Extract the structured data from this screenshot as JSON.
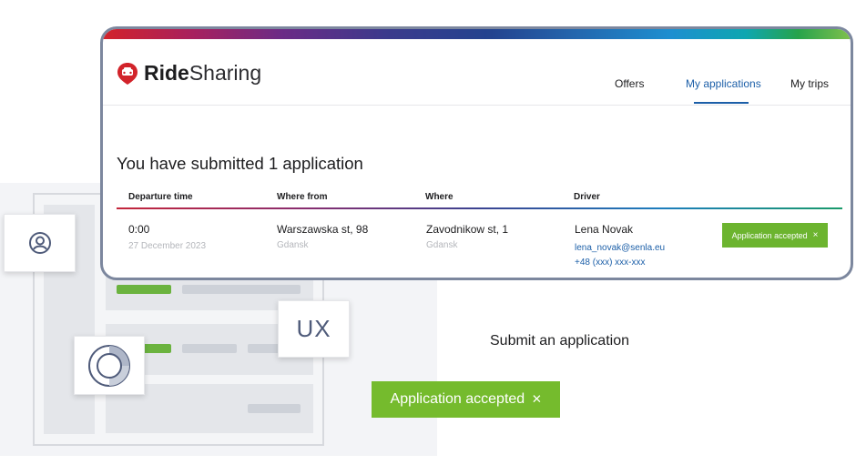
{
  "app": {
    "logo_bold": "Ride",
    "logo_light": "Sharing",
    "brand_color": "#d2232a"
  },
  "nav": {
    "offers": "Offers",
    "my_applications": "My applications",
    "my_trips": "My trips",
    "active_color": "#1c5fa8"
  },
  "page": {
    "headline": "You have submitted 1 application"
  },
  "table": {
    "headers": [
      "Departure time",
      "Where from",
      "Where",
      "Driver"
    ],
    "row": {
      "time": "0:00",
      "date": "27 December 2023",
      "from_street": "Warszawska st, 98",
      "from_city": "Gdansk",
      "to_street": "Zavodnikow st, 1",
      "to_city": "Gdansk",
      "driver_name": "Lena Novak",
      "driver_email": "lena_novak@senla.eu",
      "driver_phone": "+48 (xxx) xxx-xxx",
      "status": "Application accepted",
      "status_color": "#6cb42f"
    }
  },
  "illustration": {
    "ux_label": "UX",
    "icons": [
      "user-icon",
      "ring-chart-icon",
      "close-icon"
    ]
  },
  "callout": {
    "submit_label": "Submit an application",
    "accepted_label": "Application accepted",
    "accepted_color": "#75bb2d"
  }
}
